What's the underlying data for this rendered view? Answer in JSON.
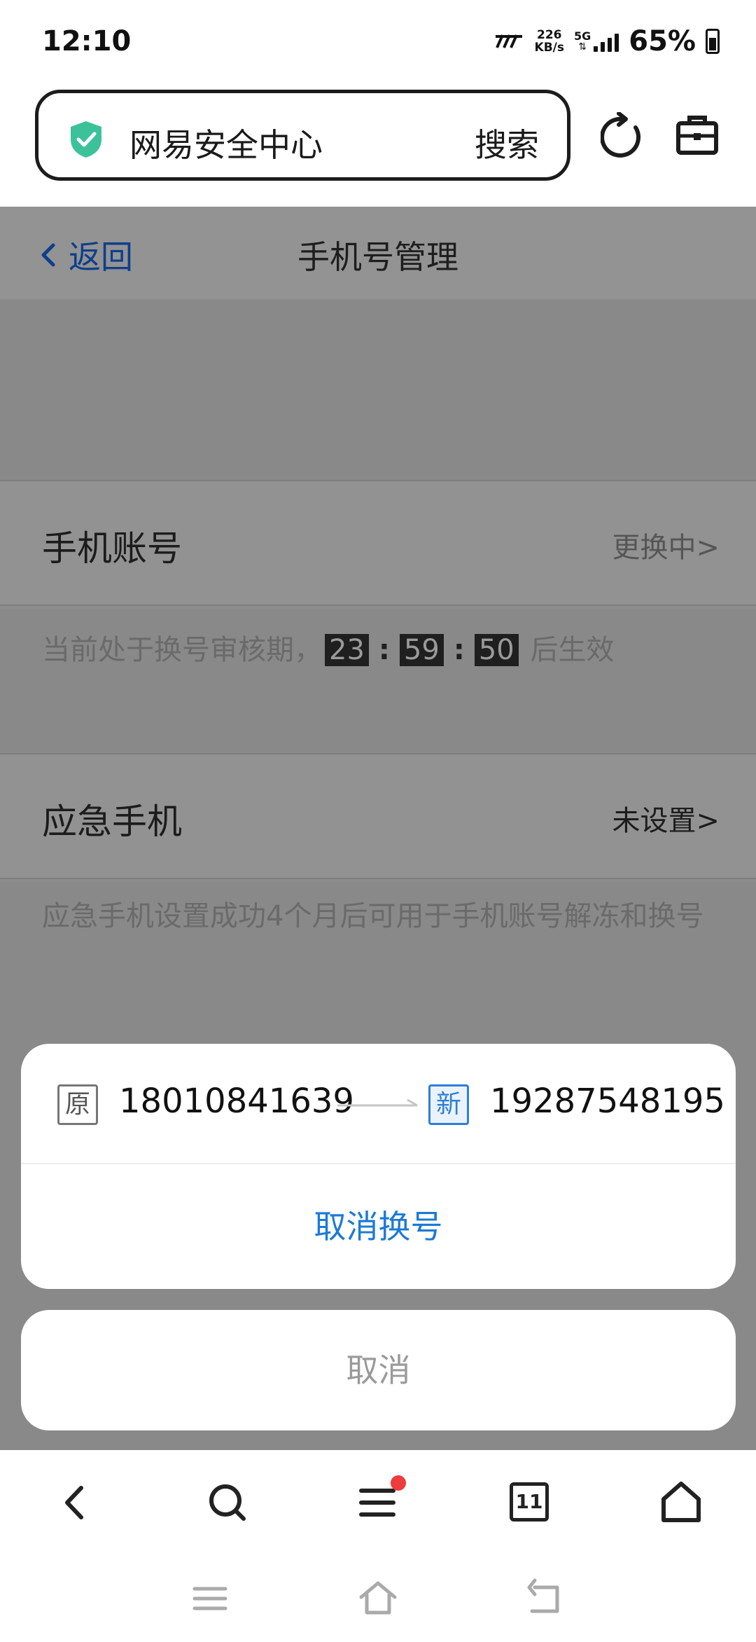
{
  "status_bar": {
    "time": "12:10",
    "net_speed_value": "226",
    "net_speed_unit": "KB/s",
    "network": "5G",
    "battery": "65%"
  },
  "address_bar": {
    "title": "网易安全中心",
    "search_label": "搜索",
    "icons": [
      "shield-check-icon",
      "reload-icon",
      "toolbox-icon"
    ]
  },
  "page": {
    "back_label": "返回",
    "title": "手机号管理",
    "phone_account": {
      "label": "手机账号",
      "value": "更换中>",
      "hint_prefix": "当前处于换号审核期，",
      "countdown": [
        "23",
        "59",
        "50"
      ],
      "hint_suffix": "后生效"
    },
    "emergency_phone": {
      "label": "应急手机",
      "value": "未设置>",
      "hint": "应急手机设置成功4个月后可用于手机账号解冻和换号"
    }
  },
  "sheet": {
    "old_tag": "原",
    "old_number": "18010841639",
    "new_tag": "新",
    "new_number": "19287548195",
    "action_label": "取消换号",
    "cancel_label": "取消"
  },
  "bottom_bar": {
    "tab_count": "11",
    "icons": [
      "back-icon",
      "search-icon",
      "menu-icon",
      "tabs-icon",
      "home-icon"
    ]
  },
  "colors": {
    "accent_blue": "#1c7ad6",
    "dim_overlay": "#8d8d8d",
    "notification_red": "#ef3b3b"
  }
}
